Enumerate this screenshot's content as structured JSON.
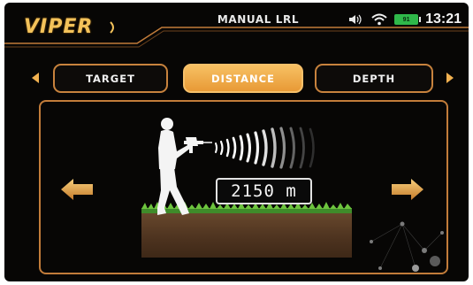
{
  "header": {
    "logo": "VIPER",
    "mode_title": "MANUAL LRL",
    "battery_level": "91",
    "clock": "13:21"
  },
  "tabs": [
    {
      "label": "TARGET",
      "active": false
    },
    {
      "label": "DISTANCE",
      "active": true
    },
    {
      "label": "DEPTH",
      "active": false
    }
  ],
  "main": {
    "distance_readout": "2150 m"
  },
  "colors": {
    "accent": "#f0a845",
    "border": "#c27c3a",
    "background": "#070605",
    "battery": "#2fb84a"
  },
  "icons": [
    "speaker-icon",
    "wifi-icon",
    "battery-icon",
    "tab-left-arrow-icon",
    "tab-right-arrow-icon",
    "decrease-arrow-icon",
    "increase-arrow-icon"
  ]
}
